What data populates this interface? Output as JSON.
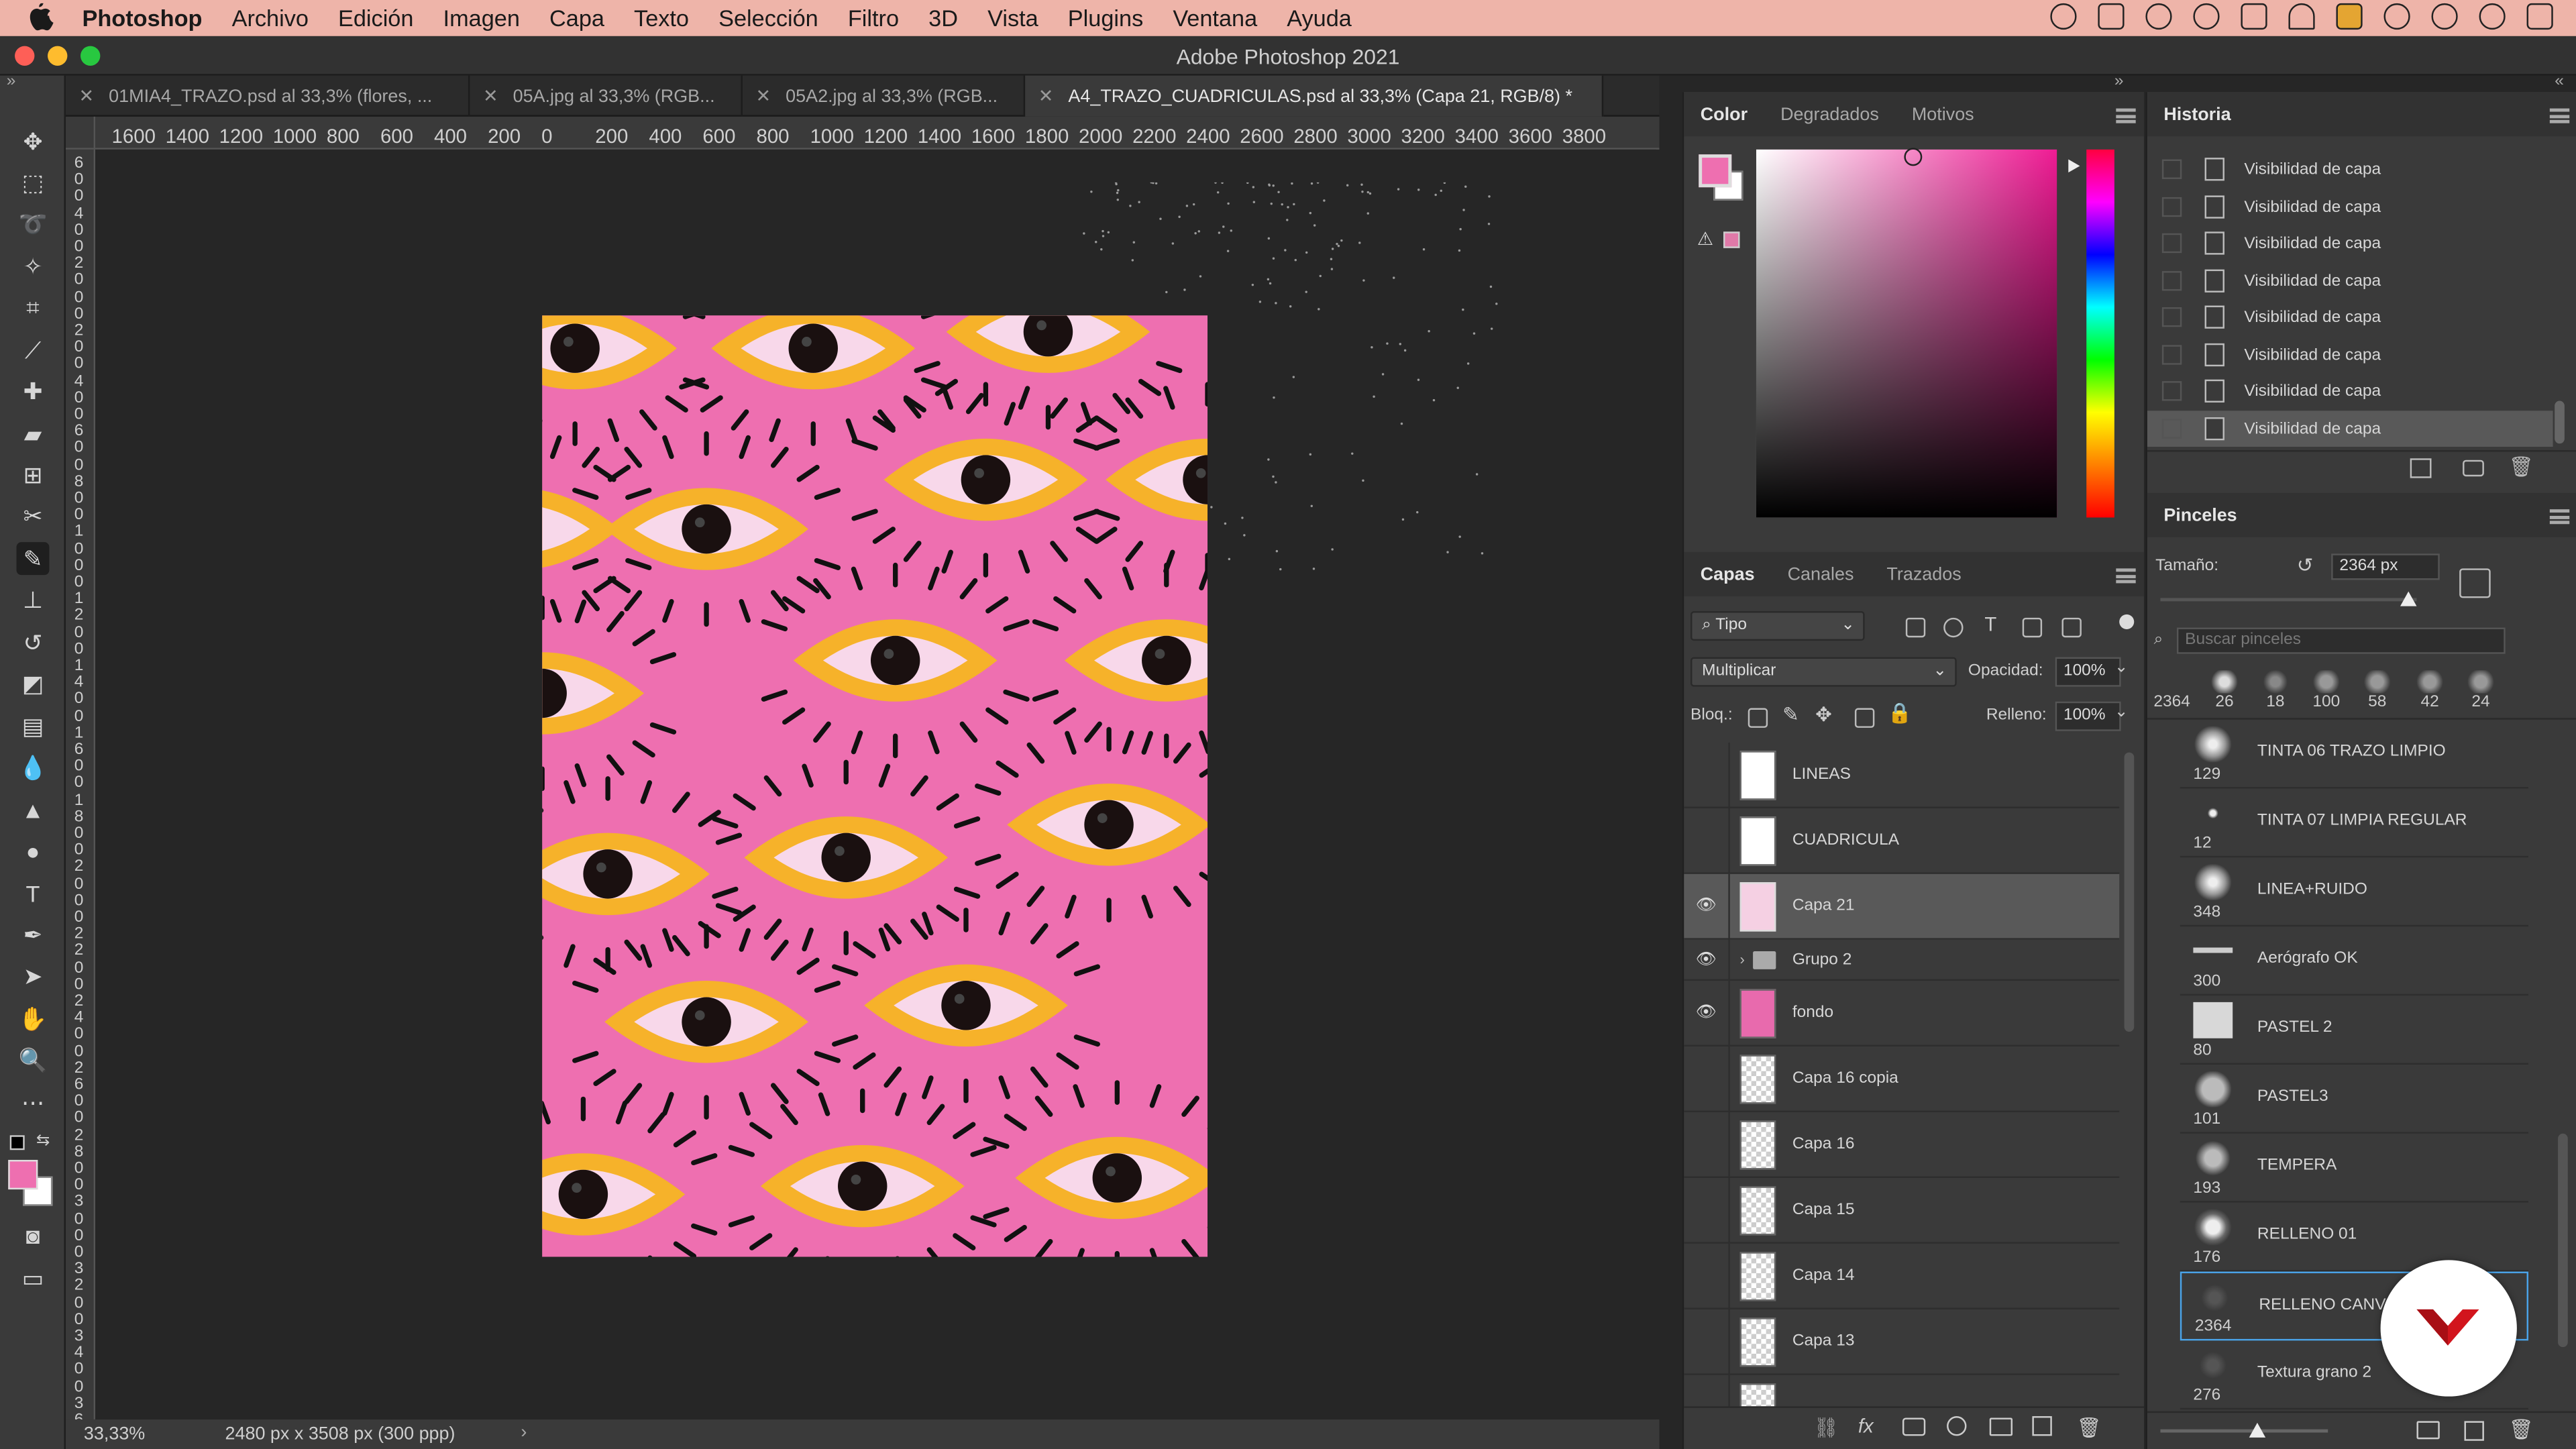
{
  "menubar": {
    "app": "Photoshop",
    "items": [
      "Archivo",
      "Edición",
      "Imagen",
      "Capa",
      "Texto",
      "Selección",
      "Filtro",
      "3D",
      "Vista",
      "Plugins",
      "Ventana",
      "Ayuda"
    ]
  },
  "window": {
    "title": "Adobe Photoshop 2021"
  },
  "tabs": [
    {
      "label": "01MIA4_TRAZO.psd al 33,3% (flores, ..."
    },
    {
      "label": "05A.jpg al 33,3% (RGB..."
    },
    {
      "label": "05A2.jpg al 33,3% (RGB..."
    },
    {
      "label": "A4_TRAZO_CUADRICULAS.psd al 33,3% (Capa 21, RGB/8) *"
    }
  ],
  "ruler_h": [
    "1600",
    "1400",
    "1200",
    "1000",
    "800",
    "600",
    "400",
    "200",
    "0",
    "200",
    "400",
    "600",
    "800",
    "1000",
    "1200",
    "1400",
    "1600",
    "1800",
    "2000",
    "2200",
    "2400",
    "2600",
    "2800",
    "3000",
    "3200",
    "3400",
    "3600",
    "3800"
  ],
  "ruler_v": [
    "6",
    "0",
    "0",
    "4",
    "0",
    "0",
    "2",
    "0",
    "0",
    "0",
    "2",
    "0",
    "0",
    "4",
    "0",
    "0",
    "6",
    "0",
    "0",
    "8",
    "0",
    "0",
    "1",
    "0",
    "0",
    "0",
    "1",
    "2",
    "0",
    "0",
    "1",
    "4",
    "0",
    "0",
    "1",
    "6",
    "0",
    "0",
    "1",
    "8",
    "0",
    "0",
    "2",
    "0",
    "0",
    "0",
    "2",
    "2",
    "0",
    "0",
    "2",
    "4",
    "0",
    "0",
    "2",
    "6",
    "0",
    "0",
    "2",
    "8",
    "0",
    "0",
    "3",
    "0",
    "0",
    "0",
    "3",
    "2",
    "0",
    "0",
    "3",
    "4",
    "0",
    "0",
    "3",
    "6",
    "0",
    "0"
  ],
  "status": {
    "zoom": "33,33%",
    "doc_info": "2480 px x 3508 px (300 ppp)"
  },
  "colors": {
    "foreground": "#ee6fb0",
    "background": "#ffffff",
    "canvas_pink": "#ee6fb0",
    "accent_yellow": "#f5b52a"
  },
  "color_panel": {
    "tabs": [
      "Color",
      "Degradados",
      "Motivos"
    ]
  },
  "history_panel": {
    "title": "Historia",
    "items": [
      "Visibilidad de capa",
      "Visibilidad de capa",
      "Visibilidad de capa",
      "Visibilidad de capa",
      "Visibilidad de capa",
      "Visibilidad de capa",
      "Visibilidad de capa",
      "Visibilidad de capa"
    ]
  },
  "layers_panel": {
    "tabs": [
      "Capas",
      "Canales",
      "Trazados"
    ],
    "filter": "Tipo",
    "blend_mode": "Multiplicar",
    "opacity_label": "Opacidad:",
    "opacity": "100%",
    "lock_label": "Bloq.:",
    "fill_label": "Relleno:",
    "fill": "100%",
    "layers": [
      {
        "name": "LINEAS",
        "visible": false,
        "selected": false
      },
      {
        "name": "CUADRICULA",
        "visible": false,
        "selected": false
      },
      {
        "name": "Capa 21",
        "visible": true,
        "selected": true
      },
      {
        "name": "Grupo 2",
        "visible": true,
        "selected": false
      },
      {
        "name": "fondo",
        "visible": true,
        "selected": false
      },
      {
        "name": "Capa 16 copia",
        "visible": false,
        "selected": false
      },
      {
        "name": "Capa 16",
        "visible": false,
        "selected": false
      },
      {
        "name": "Capa 15",
        "visible": false,
        "selected": false
      },
      {
        "name": "Capa 14",
        "visible": false,
        "selected": false
      },
      {
        "name": "Capa 13",
        "visible": false,
        "selected": false
      }
    ]
  },
  "brushes_panel": {
    "title": "Pinceles",
    "size_label": "Tamaño:",
    "size_value": "2364 px",
    "search_placeholder": "Buscar pinceles",
    "recent_sizes": [
      "2364",
      "26",
      "18",
      "100",
      "58",
      "42",
      "24"
    ],
    "brushes": [
      {
        "size": "129",
        "name": "TINTA 06 TRAZO LIMPIO"
      },
      {
        "size": "12",
        "name": "TINTA 07 LIMPIA REGULAR"
      },
      {
        "size": "348",
        "name": "LINEA+RUIDO"
      },
      {
        "size": "300",
        "name": "Aerógrafo OK"
      },
      {
        "size": "80",
        "name": "PASTEL 2"
      },
      {
        "size": "101",
        "name": "PASTEL3"
      },
      {
        "size": "193",
        "name": "TEMPERA"
      },
      {
        "size": "176",
        "name": "RELLENO 01"
      },
      {
        "size": "2364",
        "name": "RELLENO CANVA"
      },
      {
        "size": "276",
        "name": "Textura grano 2"
      }
    ]
  }
}
